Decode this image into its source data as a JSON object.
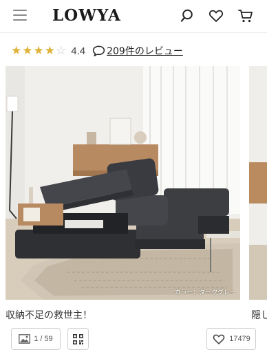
{
  "header": {
    "logo": "LOWYA",
    "icons": [
      "menu-icon",
      "search-icon",
      "heart-icon",
      "cart-icon"
    ]
  },
  "rating": {
    "stars_filled": 4,
    "stars_total": 5,
    "score": "4.4",
    "reviews_label": "209件のレビュー"
  },
  "product": {
    "image_caption": "カラー：ダークグレー",
    "title": "収納不足の救世主！",
    "next_title": "隠し"
  },
  "actions": {
    "gallery_count": "1 / 59",
    "favorites_count": "17479"
  },
  "colors": {
    "star": "#e0b23a",
    "sofa": "#3d3e42",
    "text": "#333333"
  }
}
